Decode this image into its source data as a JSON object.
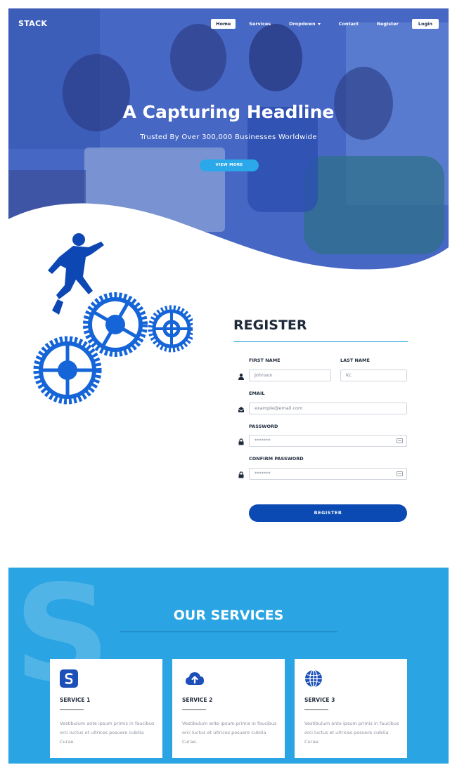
{
  "nav": {
    "brand": "STACK",
    "items": [
      {
        "label": "Home",
        "active": true
      },
      {
        "label": "Services"
      },
      {
        "label": "Dropdown",
        "dropdown": true
      },
      {
        "label": "Contact"
      },
      {
        "label": "Register"
      },
      {
        "label": "Login",
        "button": true
      }
    ]
  },
  "hero": {
    "title": "A Capturing Headline",
    "subtitle": "Trusted By Over 300,000 Businesses Worldwide",
    "cta": "VIEW MORE"
  },
  "register": {
    "title": "REGISTER",
    "first_name": {
      "label": "FIRST NAME",
      "value": "Johnson"
    },
    "last_name": {
      "label": "LAST NAME",
      "value": "Kc"
    },
    "email": {
      "label": "EMAIL",
      "placeholder": "example@email.com"
    },
    "password": {
      "label": "PASSWORD",
      "value": "*******"
    },
    "confirm_password": {
      "label": "CONFIRM PASSWORD",
      "value": "*******"
    },
    "submit": "REGISTER"
  },
  "services": {
    "title": "OUR SERVICES",
    "watermark": "S",
    "cards": [
      {
        "title": "SERVICE 1",
        "icon": "s-logo-icon",
        "text": "Vestibulum ante ipsum primis in faucibus orci luctus et ultrices posuere cubilia Curae."
      },
      {
        "title": "SERVICE 2",
        "icon": "cloud-upload-icon",
        "text": "Vestibulum ante ipsum primis in faucibus orci luctus et ultrices posuere cubilia Curae."
      },
      {
        "title": "SERVICE 3",
        "icon": "globe-icon",
        "text": "Vestibulum ante ipsum primis in faucibus orci luctus et ultrices posuere cubilia Curae."
      }
    ]
  },
  "colors": {
    "primary_blue": "#0b4ab3",
    "accent_cyan": "#2aa8ea",
    "services_bg": "#2aa4e2",
    "hero_overlay": "#3a5cb8"
  }
}
